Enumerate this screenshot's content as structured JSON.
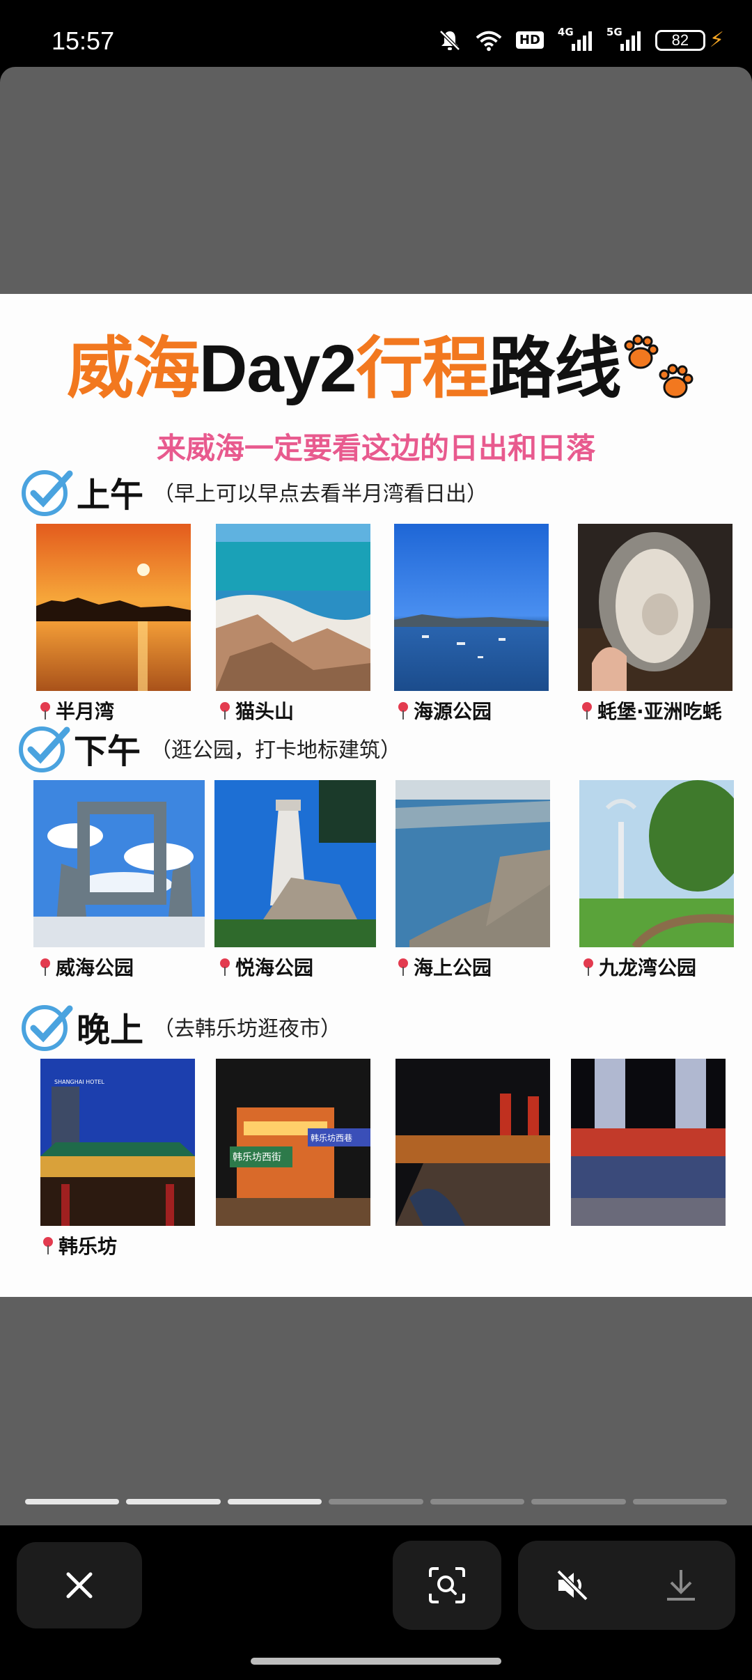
{
  "status_bar": {
    "time": "15:57",
    "network_4g": "4G",
    "network_5g": "5G",
    "hd_badge": "HD",
    "battery": "82"
  },
  "poster": {
    "title_parts": [
      "威海",
      "Day2",
      "行程",
      "路线"
    ],
    "subtitle": "来威海一定要看这边的日出和日落",
    "sections": [
      {
        "heading": "上午",
        "note": "（早上可以早点去看半月湾看日出）",
        "places": [
          "半月湾",
          "猫头山",
          "海源公园",
          "蚝堡·亚洲吃蚝"
        ]
      },
      {
        "heading": "下午",
        "note": "（逛公园，打卡地标建筑）",
        "places": [
          "威海公园",
          "悦海公园",
          "海上公园",
          "九龙湾公园"
        ]
      },
      {
        "heading": "晚上",
        "note": "（去韩乐坊逛夜市）",
        "places": [
          "韩乐坊"
        ]
      }
    ],
    "signs": {
      "street_sign": "韩乐坊西巷",
      "street_sign_2": "韩乐坊西街",
      "hotel": "SHANGHAI HOTEL"
    }
  },
  "viewer": {
    "progress_segments": 7,
    "active_segments": 3
  },
  "colors": {
    "accent_orange": "#f2781f",
    "subtitle_pink": "#e85a8e",
    "check_blue": "#4aa3df"
  }
}
